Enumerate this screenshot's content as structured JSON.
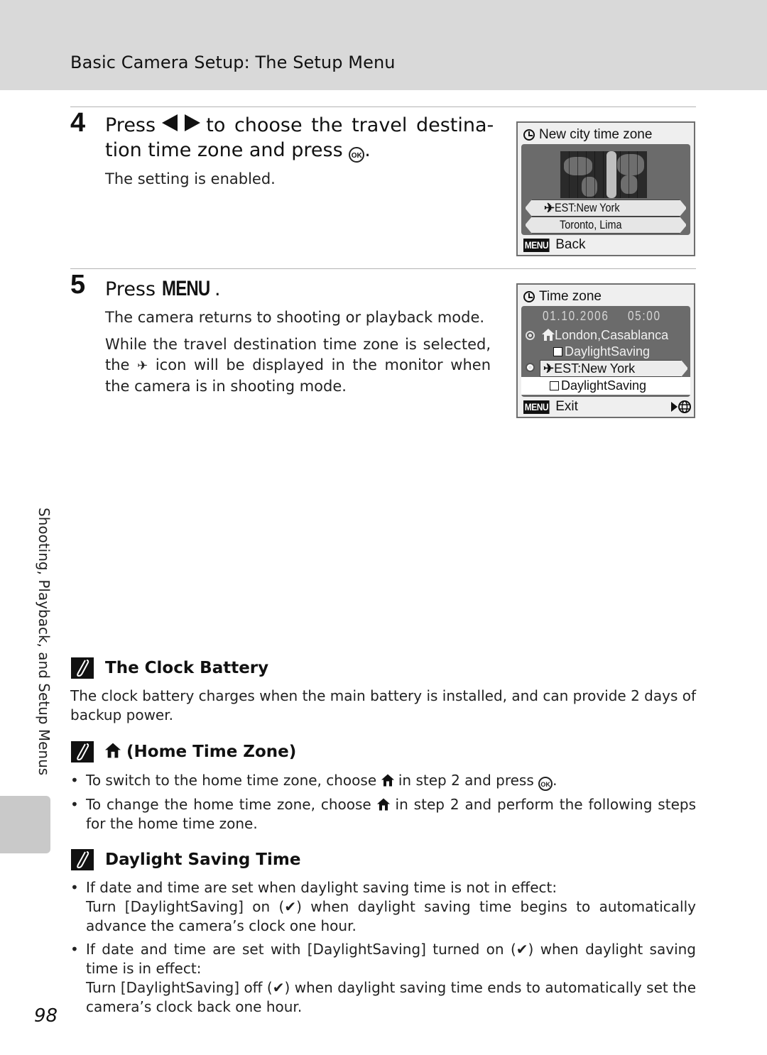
{
  "header": {
    "running_head": "Basic Camera Setup: The Setup Menu"
  },
  "steps": [
    {
      "number": "4",
      "title_pre": "Press",
      "title_mid": "to choose the travel destina-",
      "title_line2": "tion time zone and press",
      "title_end": ".",
      "icons": [
        "left-right-arrows-icon",
        "ok-button-icon"
      ],
      "body": [
        "The setting is enabled."
      ]
    },
    {
      "number": "5",
      "title_pre": "Press",
      "menu_word": "MENU",
      "title_end": ".",
      "body": [
        "The camera returns to shooting or playback mode.",
        "While the travel destination time zone is selected, the",
        "icon will be displayed in the monitor when the camera is in shooting mode."
      ]
    }
  ],
  "screens": {
    "new_city": {
      "title": "New city time zone",
      "row1": "EST:New York",
      "row2": "Toronto, Lima",
      "menu_badge": "MENU",
      "footer": "Back"
    },
    "time_zone": {
      "title": "Time zone",
      "date": "01.10.2006",
      "time": "05:00",
      "home_city": "London,Casablanca",
      "home_dst": "DaylightSaving",
      "travel_city": "EST:New York",
      "travel_dst": "DaylightSaving",
      "menu_badge": "MENU",
      "footer": "Exit"
    }
  },
  "side_tab": {
    "label": "Shooting, Playback, and Setup Menus"
  },
  "notes": [
    {
      "title": "The Clock Battery",
      "text": "The clock battery charges when the main battery is installed, and can provide 2 days of backup power."
    },
    {
      "title": "(Home Time Zone)",
      "bullets": [
        {
          "pre": "To switch to the home time zone, choose",
          "post": "in step 2 and press",
          "end": "."
        },
        {
          "pre": "To change the home time zone, choose",
          "post": "in step 2 and perform the following steps for the home time zone."
        }
      ]
    },
    {
      "title": "Daylight Saving Time",
      "bullets": [
        {
          "line1": "If date and time are set when daylight saving time is not in effect:",
          "line2_pre": "Turn [DaylightSaving] on (",
          "line2_post": ") when daylight saving time begins to automatically advance the camera’s clock one hour."
        },
        {
          "line1_pre": "If date and time are set with [DaylightSaving] turned on (",
          "line1_post": ") when daylight saving time is in effect:",
          "line2_pre": "Turn [DaylightSaving] off (",
          "line2_post": ") when daylight saving time ends to automatically set the camera’s clock back one hour."
        }
      ]
    }
  ],
  "glyphs": {
    "ok": "OK",
    "check": "✔",
    "plane": "✈"
  },
  "page_number": "98"
}
